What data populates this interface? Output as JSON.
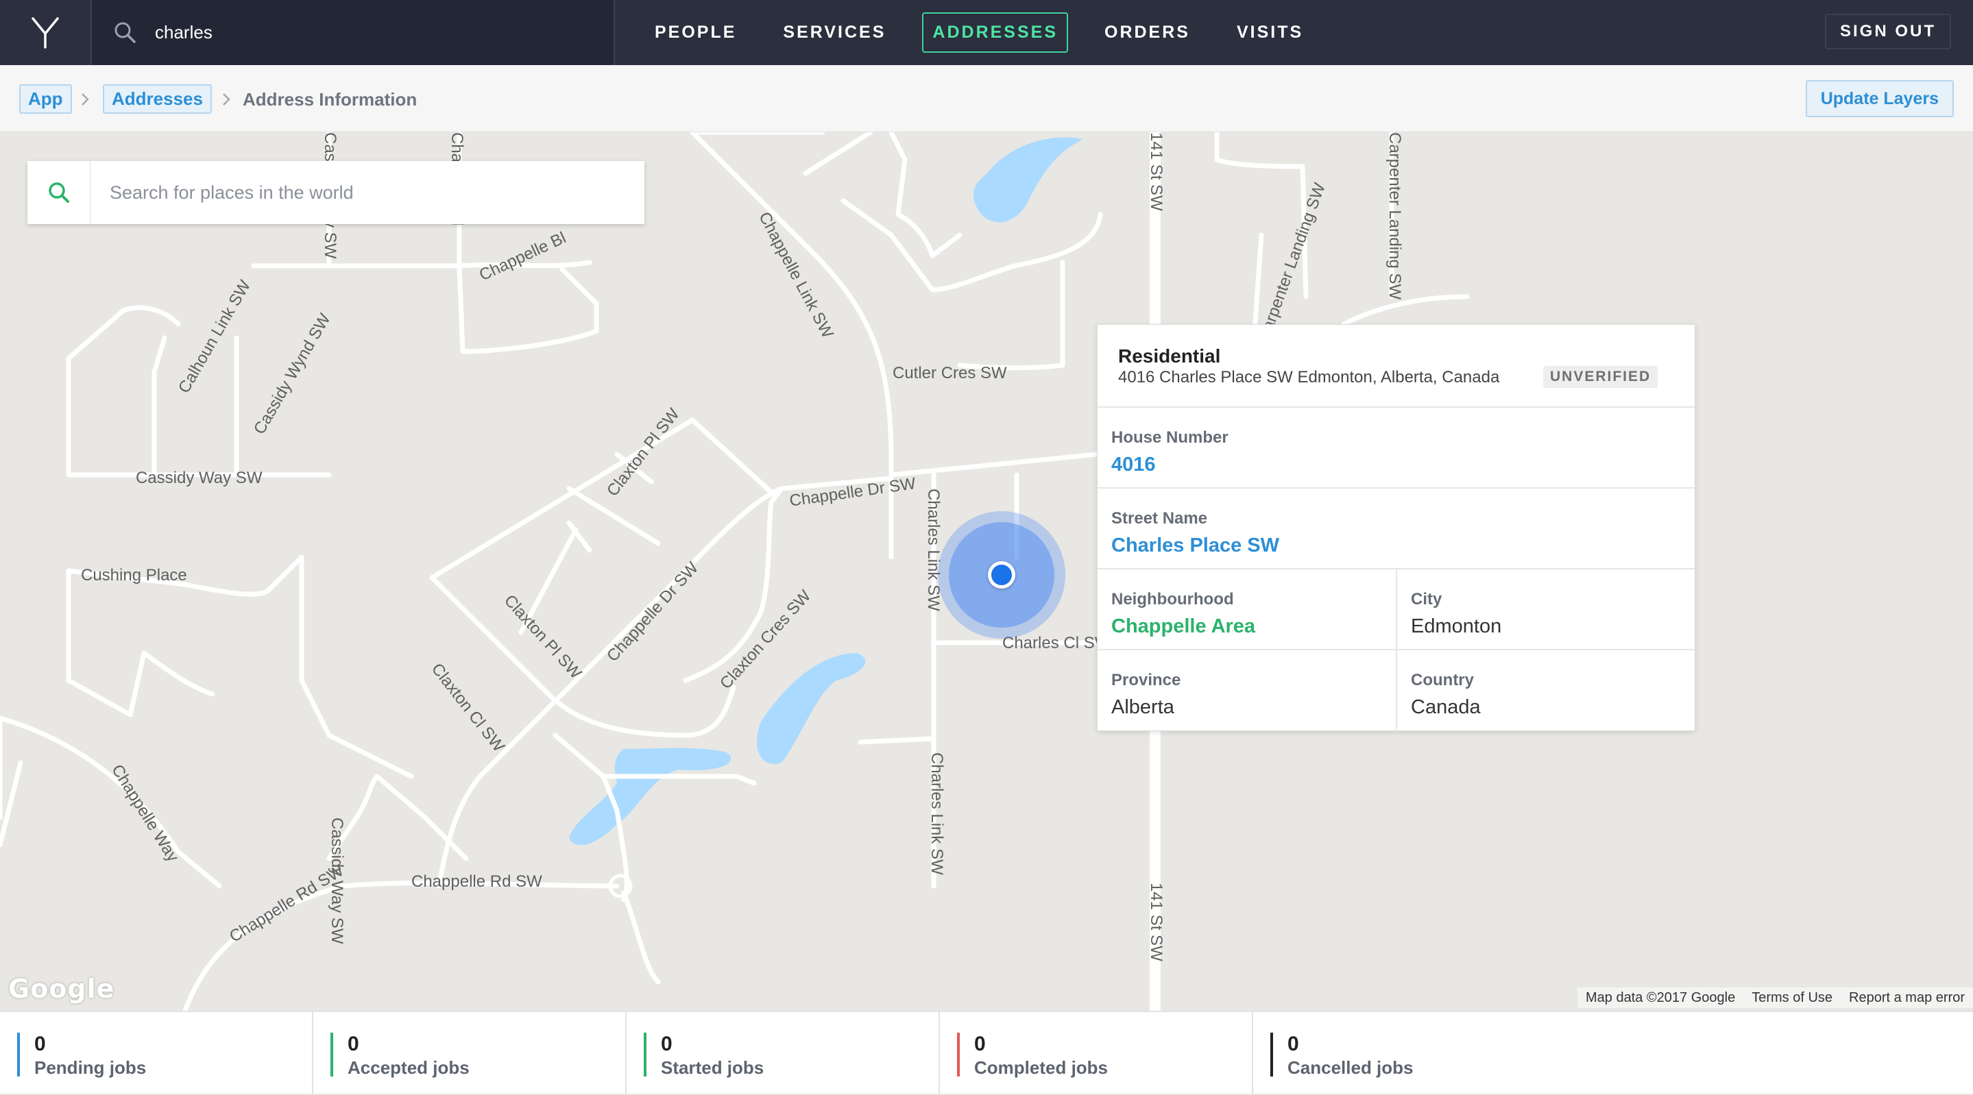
{
  "topbar": {
    "search_value": "charles",
    "nav": [
      "PEOPLE",
      "SERVICES",
      "ADDRESSES",
      "ORDERS",
      "VISITS"
    ],
    "active_nav": "ADDRESSES",
    "sign_out": "SIGN OUT"
  },
  "breadcrumb": {
    "app": "App",
    "addresses": "Addresses",
    "current": "Address Information",
    "update_layers": "Update Layers"
  },
  "map": {
    "search_placeholder": "Search for places in the world",
    "google": "Google",
    "attribution": [
      "Map data ©2017 Google",
      "Terms of Use",
      "Report a map error"
    ],
    "road_labels": [
      "Chappelle Link SW",
      "Cutler Cres SW",
      "Chappelle Dr SW",
      "Charles Link SW",
      "Charles Cl SW",
      "Claxton Pl SW",
      "Claxton Pl SW",
      "Chappelle Dr SW",
      "Claxton Cres SW",
      "Claxton Cl SW",
      "Cassidy Way SW",
      "Cassidy Wynd SW",
      "Calhoun Link SW",
      "Cushing Place",
      "Chappelle Way",
      "Chappelle Rd SW",
      "Chappelle Rd SW",
      "Charles Link SW",
      "141 St SW",
      "141 St SW",
      "Carpenter Landing SW",
      "Carpenter Landing SW",
      "Chappelle Bl",
      "Chappelle Bl",
      "Cassidy Way SW",
      "Cassidy Way SW"
    ]
  },
  "card": {
    "type": "Residential",
    "address": "4016 Charles Place SW Edmonton, Alberta, Canada",
    "badge": "UNVERIFIED",
    "house_number_label": "House Number",
    "house_number": "4016",
    "street_label": "Street Name",
    "street": "Charles Place SW",
    "neighbourhood_label": "Neighbourhood",
    "neighbourhood": "Chappelle Area",
    "city_label": "City",
    "city": "Edmonton",
    "province_label": "Province",
    "province": "Alberta",
    "country_label": "Country",
    "country": "Canada"
  },
  "stats": [
    {
      "value": "0",
      "label": "Pending jobs",
      "color": "#2d8fd5"
    },
    {
      "value": "0",
      "label": "Accepted jobs",
      "color": "#2ab36b"
    },
    {
      "value": "0",
      "label": "Started jobs",
      "color": "#2ab36b"
    },
    {
      "value": "0",
      "label": "Completed jobs",
      "color": "#e05a5a"
    },
    {
      "value": "0",
      "label": "Cancelled jobs",
      "color": "#222222"
    }
  ],
  "icons": {
    "logo": "y-logo-icon",
    "search": "search-icon",
    "breadcrumb_sep": "chevron-right-icon",
    "map_pin": "location-dot-icon"
  }
}
